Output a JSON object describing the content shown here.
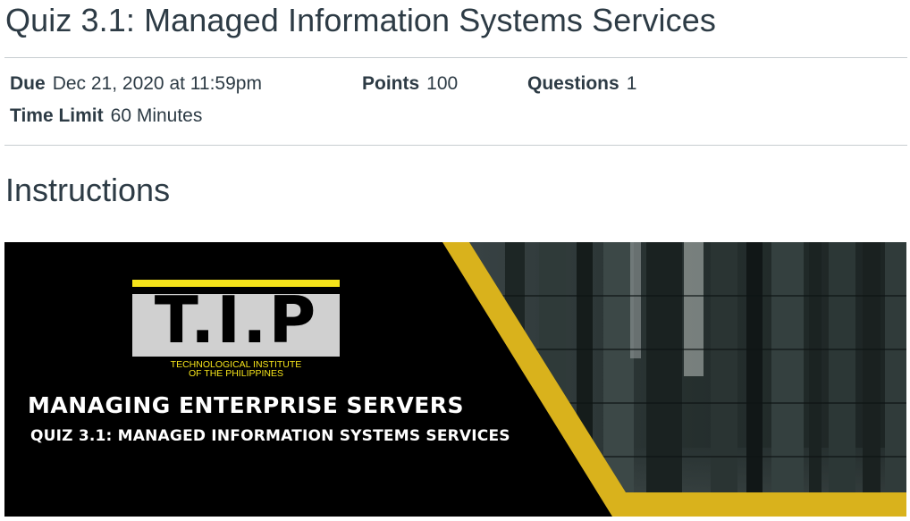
{
  "quiz": {
    "title": "Quiz 3.1: Managed Information Systems Services"
  },
  "details": {
    "due_label": "Due",
    "due_value": "Dec 21, 2020 at 11:59pm",
    "points_label": "Points",
    "points_value": "100",
    "questions_label": "Questions",
    "questions_value": "1",
    "time_limit_label": "Time Limit",
    "time_limit_value": "60 Minutes"
  },
  "instructions": {
    "heading": "Instructions",
    "banner": {
      "logo_text": "T.I.P",
      "logo_caption_line1": "TECHNOLOGICAL INSTITUTE",
      "logo_caption_line2": "OF THE PHILIPPINES",
      "title": "MANAGING ENTERPRISE SERVERS",
      "subtitle": "QUIZ 3.1: MANAGED INFORMATION SYSTEMS SERVICES"
    }
  },
  "colors": {
    "text": "#2d3b45",
    "divider": "#c7cdd1",
    "banner_accent_yellow": "#d9b21c",
    "logo_yellow": "#f5e31a"
  }
}
